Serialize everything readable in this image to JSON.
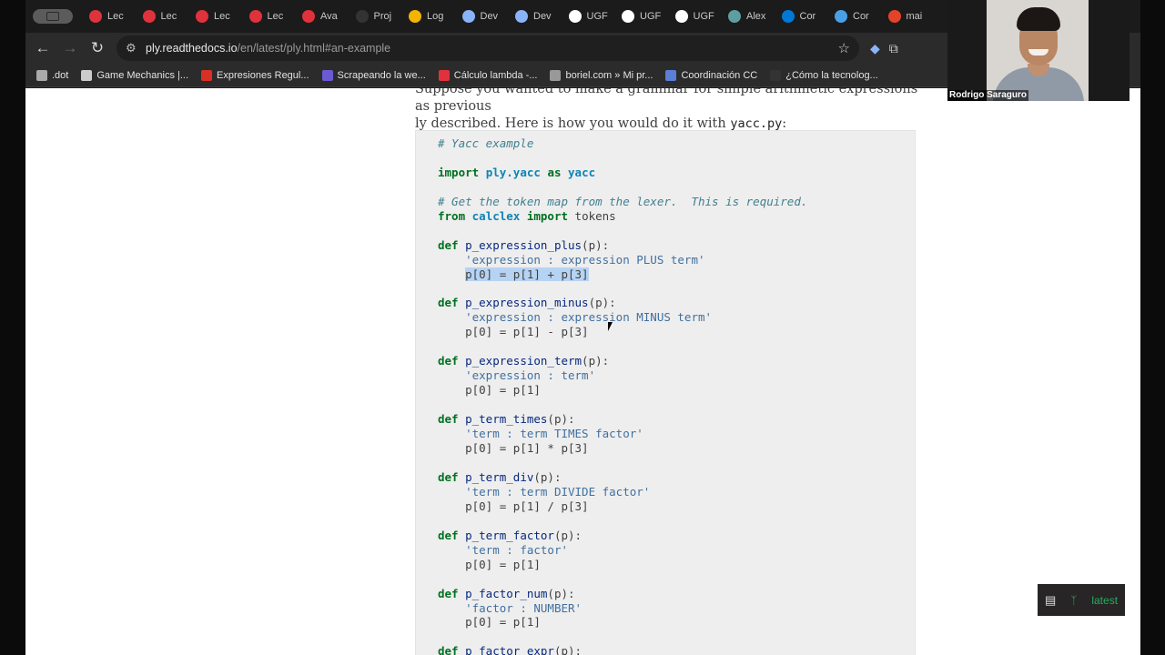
{
  "tabs": [
    {
      "label": "Lec",
      "icon": "lecture-icon",
      "color": "#e0323c"
    },
    {
      "label": "Lec",
      "icon": "lecture-icon",
      "color": "#e0323c"
    },
    {
      "label": "Lec",
      "icon": "lecture-icon",
      "color": "#e0323c"
    },
    {
      "label": "Lec",
      "icon": "lecture-icon",
      "color": "#e0323c"
    },
    {
      "label": "Ava",
      "icon": "lecture-icon",
      "color": "#e0323c"
    },
    {
      "label": "Proj",
      "icon": "github-icon",
      "color": "#333333"
    },
    {
      "label": "Log",
      "icon": "drive-icon",
      "color": "#f4b400"
    },
    {
      "label": "Dev",
      "icon": "circle-icon",
      "color": "#8ab4f8"
    },
    {
      "label": "Dev",
      "icon": "circle-icon",
      "color": "#8ab4f8"
    },
    {
      "label": "UGF",
      "icon": "ugf-icon",
      "color": "#ffffff"
    },
    {
      "label": "UGF",
      "icon": "ugf-icon",
      "color": "#ffffff"
    },
    {
      "label": "UGF",
      "icon": "ugf-icon",
      "color": "#ffffff"
    },
    {
      "label": "Alex",
      "icon": "s-icon",
      "color": "#5f9ea0"
    },
    {
      "label": "Cor",
      "icon": "outlook-icon",
      "color": "#0078d4"
    },
    {
      "label": "Cor",
      "icon": "onedrive-icon",
      "color": "#4aa0e6"
    },
    {
      "label": "mai",
      "icon": "gitlab-icon",
      "color": "#e24329"
    }
  ],
  "address_bar": {
    "url_host": "ply.readthedocs.io",
    "url_path": "/en/latest/ply.html#an-example"
  },
  "bookmarks": [
    {
      "label": ".dot",
      "color": "#aaaaaa"
    },
    {
      "label": "Game Mechanics |...",
      "color": "#cccccc"
    },
    {
      "label": "Expresiones Regul...",
      "color": "#d93025"
    },
    {
      "label": "Scrapeando la we...",
      "color": "#6b5bd2"
    },
    {
      "label": "Cálculo lambda -...",
      "color": "#e0323c"
    },
    {
      "label": "boriel.com » Mi pr...",
      "color": "#999999"
    },
    {
      "label": "Coordinación CC",
      "color": "#5b7fd6"
    },
    {
      "label": "¿Cómo la tecnolog...",
      "color": "#333333"
    }
  ],
  "prose": {
    "line1": "Suppose you wanted to make a grammar for simple arithmetic expressions as previous",
    "line2_prefix": "ly described. Here is how you would do it with ",
    "line2_code": "yacc.py",
    "line2_suffix": ":"
  },
  "code_lines": [
    {
      "parts": [
        {
          "t": "# Yacc example",
          "c": "c"
        }
      ]
    },
    {
      "parts": []
    },
    {
      "parts": [
        {
          "t": "import",
          "c": "k"
        },
        {
          "t": " "
        },
        {
          "t": "ply.yacc",
          "c": "nn"
        },
        {
          "t": " "
        },
        {
          "t": "as",
          "c": "k"
        },
        {
          "t": " "
        },
        {
          "t": "yacc",
          "c": "nn"
        }
      ]
    },
    {
      "parts": []
    },
    {
      "parts": [
        {
          "t": "# Get the token map from the lexer.  This is required.",
          "c": "c"
        }
      ]
    },
    {
      "parts": [
        {
          "t": "from",
          "c": "k"
        },
        {
          "t": " "
        },
        {
          "t": "calclex",
          "c": "nn"
        },
        {
          "t": " "
        },
        {
          "t": "import",
          "c": "k"
        },
        {
          "t": " tokens"
        }
      ]
    },
    {
      "parts": []
    },
    {
      "parts": [
        {
          "t": "def",
          "c": "k"
        },
        {
          "t": " "
        },
        {
          "t": "p_expression_plus",
          "c": "nf"
        },
        {
          "t": "(p):"
        }
      ]
    },
    {
      "parts": [
        {
          "t": "    "
        },
        {
          "t": "'expression : expression PLUS term'",
          "c": "s"
        }
      ]
    },
    {
      "parts": [
        {
          "t": "    "
        },
        {
          "t": "p[0] = p[1] + p[3]",
          "c": "hl"
        }
      ]
    },
    {
      "parts": []
    },
    {
      "parts": [
        {
          "t": "def",
          "c": "k"
        },
        {
          "t": " "
        },
        {
          "t": "p_expression_minus",
          "c": "nf"
        },
        {
          "t": "(p):"
        }
      ]
    },
    {
      "parts": [
        {
          "t": "    "
        },
        {
          "t": "'expression : expression MINUS term'",
          "c": "s"
        }
      ]
    },
    {
      "parts": [
        {
          "t": "    p[0] = p[1] - p[3]"
        }
      ]
    },
    {
      "parts": []
    },
    {
      "parts": [
        {
          "t": "def",
          "c": "k"
        },
        {
          "t": " "
        },
        {
          "t": "p_expression_term",
          "c": "nf"
        },
        {
          "t": "(p):"
        }
      ]
    },
    {
      "parts": [
        {
          "t": "    "
        },
        {
          "t": "'expression : term'",
          "c": "s"
        }
      ]
    },
    {
      "parts": [
        {
          "t": "    p[0] = p[1]"
        }
      ]
    },
    {
      "parts": []
    },
    {
      "parts": [
        {
          "t": "def",
          "c": "k"
        },
        {
          "t": " "
        },
        {
          "t": "p_term_times",
          "c": "nf"
        },
        {
          "t": "(p):"
        }
      ]
    },
    {
      "parts": [
        {
          "t": "    "
        },
        {
          "t": "'term : term TIMES factor'",
          "c": "s"
        }
      ]
    },
    {
      "parts": [
        {
          "t": "    p[0] = p[1] * p[3]"
        }
      ]
    },
    {
      "parts": []
    },
    {
      "parts": [
        {
          "t": "def",
          "c": "k"
        },
        {
          "t": " "
        },
        {
          "t": "p_term_div",
          "c": "nf"
        },
        {
          "t": "(p):"
        }
      ]
    },
    {
      "parts": [
        {
          "t": "    "
        },
        {
          "t": "'term : term DIVIDE factor'",
          "c": "s"
        }
      ]
    },
    {
      "parts": [
        {
          "t": "    p[0] = p[1] / p[3]"
        }
      ]
    },
    {
      "parts": []
    },
    {
      "parts": [
        {
          "t": "def",
          "c": "k"
        },
        {
          "t": " "
        },
        {
          "t": "p_term_factor",
          "c": "nf"
        },
        {
          "t": "(p):"
        }
      ]
    },
    {
      "parts": [
        {
          "t": "    "
        },
        {
          "t": "'term : factor'",
          "c": "s"
        }
      ]
    },
    {
      "parts": [
        {
          "t": "    p[0] = p[1]"
        }
      ]
    },
    {
      "parts": []
    },
    {
      "parts": [
        {
          "t": "def",
          "c": "k"
        },
        {
          "t": " "
        },
        {
          "t": "p_factor_num",
          "c": "nf"
        },
        {
          "t": "(p):"
        }
      ]
    },
    {
      "parts": [
        {
          "t": "    "
        },
        {
          "t": "'factor : NUMBER'",
          "c": "s"
        }
      ]
    },
    {
      "parts": [
        {
          "t": "    p[0] = p[1]"
        }
      ]
    },
    {
      "parts": []
    },
    {
      "parts": [
        {
          "t": "def",
          "c": "k"
        },
        {
          "t": " "
        },
        {
          "t": "p_factor_expr",
          "c": "nf"
        },
        {
          "t": "(p):"
        }
      ]
    }
  ],
  "rtd_badge": {
    "version": "latest",
    "icon": "book-icon"
  },
  "webcam": {
    "participant_name": "Rodrigo Saraguro"
  }
}
